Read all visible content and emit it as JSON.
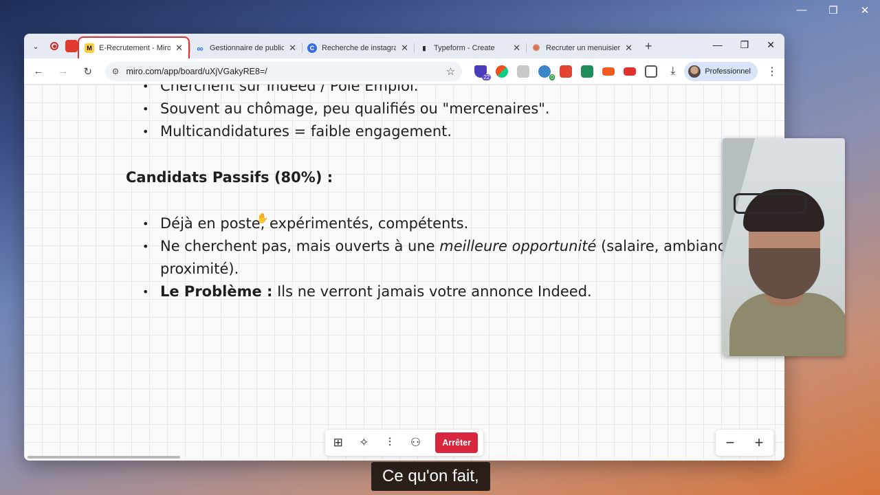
{
  "system": {
    "minimize": "—",
    "restore": "❐",
    "close": "✕"
  },
  "browser": {
    "tabs": [
      {
        "title": "E-Recrutement - Miro",
        "favicon": "M",
        "favicon_color": "#ffd02f",
        "active": true
      },
      {
        "title": "Gestionnaire de publicités",
        "favicon": "∞",
        "favicon_color": "#e8eefb",
        "active": false
      },
      {
        "title": "Recherche de instagram",
        "favicon": "C",
        "favicon_color": "#3b6fe0",
        "active": false
      },
      {
        "title": "Typeform - Create",
        "favicon": "▮",
        "favicon_color": "#222222",
        "active": false
      },
      {
        "title": "Recruter un menuisier",
        "favicon": "✺",
        "favicon_color": "#f2e3dc",
        "active": false
      }
    ],
    "new_tab": "+",
    "window_controls": {
      "minimize": "—",
      "restore": "❐",
      "close": "✕"
    },
    "url": "miro.com/app/board/uXjVGakyRE8=/",
    "profile_name": "Professionnel",
    "extension_badges": {
      "first": "22",
      "second": "0"
    }
  },
  "document": {
    "top_bullets": [
      "Cherchent sur Indeed / Pôle Emploi.",
      "Souvent au chômage, peu qualifiés ou \"mercenaires\".",
      "Multicandidatures = faible engagement."
    ],
    "heading": "Candidats Passifs (80%) :",
    "bullet1": "Déjà en poste, expérimentés, compétents.",
    "bullet2_pre": "Ne cherchent pas, mais ouverts à une ",
    "bullet2_em": "meilleure opportunité",
    "bullet2_post": " (salaire, ambiance, proximité).",
    "bullet3_bold": "Le Problème :",
    "bullet3_rest": " Ils ne verront jamais votre annonce Indeed."
  },
  "bottom_toolbar": {
    "stop_label": "Arrêter"
  },
  "zoom": {
    "minus": "−",
    "plus": "+"
  },
  "subtitle": "Ce qu'on fait,"
}
